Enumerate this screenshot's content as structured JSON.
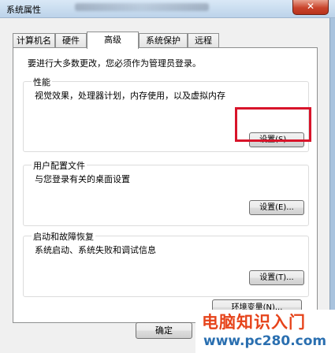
{
  "window": {
    "title": "系统属性",
    "close_symbol": "✕"
  },
  "tabs": [
    {
      "label": "计算机名"
    },
    {
      "label": "硬件"
    },
    {
      "label": "高级"
    },
    {
      "label": "系统保护"
    },
    {
      "label": "远程"
    }
  ],
  "active_tab": "高级",
  "panel": {
    "intro": "要进行大多数更改，您必须作为管理员登录。",
    "performance": {
      "title": "性能",
      "description": "视觉效果，处理器计划，内存使用，以及虚拟内存",
      "button": "设置(S)..."
    },
    "user_profiles": {
      "title": "用户配置文件",
      "description": "与您登录有关的桌面设置",
      "button": "设置(E)..."
    },
    "startup_recovery": {
      "title": "启动和故障恢复",
      "description": "系统启动、系统失败和调试信息",
      "button": "设置(T)..."
    },
    "env_button": "环境变量(N)..."
  },
  "footer": {
    "ok_button": "确定"
  },
  "watermark": {
    "title": "电脑知识入门",
    "url": "www.pc280.com"
  },
  "colors": {
    "highlight": "#d8142a",
    "watermark_title": "#e6431a",
    "watermark_url": "#2a6fb0"
  }
}
